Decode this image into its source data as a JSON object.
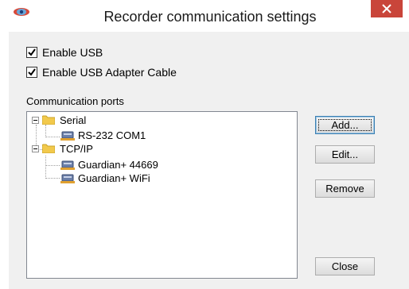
{
  "window": {
    "title": "Recorder communication settings"
  },
  "options": {
    "enable_usb": {
      "label": "Enable USB",
      "checked": true
    },
    "enable_usb_adapter": {
      "label": "Enable USB Adapter Cable",
      "checked": true
    }
  },
  "ports": {
    "section_label": "Communication ports",
    "tree": [
      {
        "label": "Serial",
        "expanded": true,
        "icon": "folder-icon",
        "children": [
          {
            "label": "RS-232 COM1",
            "icon": "device-icon"
          }
        ]
      },
      {
        "label": "TCP/IP",
        "expanded": true,
        "icon": "folder-icon",
        "children": [
          {
            "label": "Guardian+ 44669",
            "icon": "device-icon"
          },
          {
            "label": "Guardian+ WiFi",
            "icon": "device-icon"
          }
        ]
      }
    ]
  },
  "buttons": {
    "add": "Add...",
    "edit": "Edit...",
    "remove": "Remove",
    "close": "Close"
  },
  "colors": {
    "close_button": "#c9453a",
    "dialog_background": "#f0f0f0",
    "folder": "#f2c94c"
  }
}
